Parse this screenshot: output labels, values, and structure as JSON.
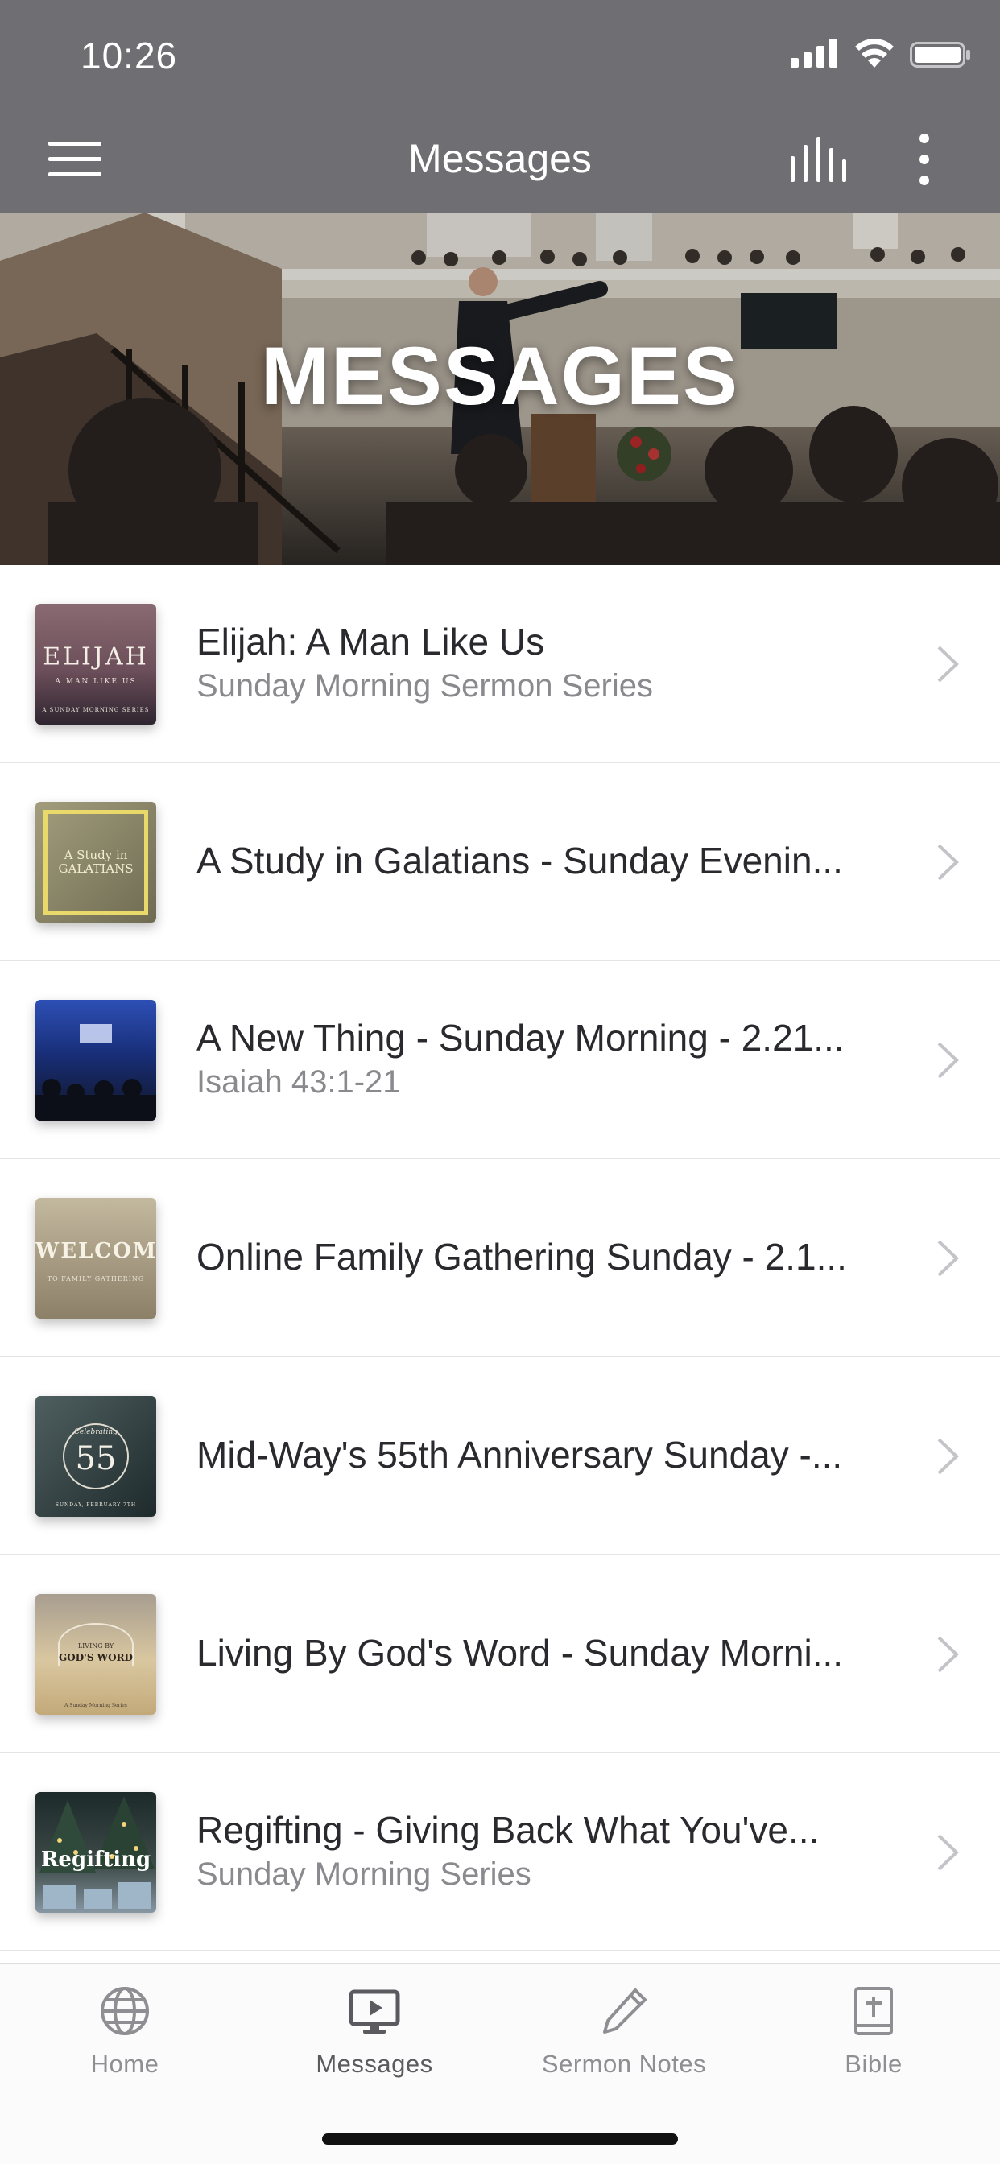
{
  "status_bar": {
    "time": "10:26"
  },
  "nav": {
    "title": "Messages"
  },
  "hero": {
    "title": "MESSAGES"
  },
  "messages": [
    {
      "title": "Elijah: A Man Like Us",
      "subtitle": "Sunday Morning Sermon Series",
      "thumb": {
        "text": "ELIJAH",
        "subtext": "A MAN LIKE US",
        "caption": "A SUNDAY MORNING SERIES",
        "colors": [
          "#3b2f3a",
          "#8a6a72"
        ]
      }
    },
    {
      "title": "A Study in Galatians - Sunday Evenin...",
      "subtitle": "",
      "thumb": {
        "text": "A Study in GALATIANS",
        "subtext": "",
        "caption": "",
        "colors": [
          "#5a5640",
          "#8b8664"
        ]
      }
    },
    {
      "title": "A New Thing - Sunday Morning - 2.21...",
      "subtitle": "Isaiah 43:1-21",
      "thumb": {
        "text": "",
        "subtext": "",
        "caption": "",
        "colors": [
          "#0f1f5a",
          "#3f5aa8"
        ]
      }
    },
    {
      "title": "Online Family Gathering Sunday - 2.1...",
      "subtitle": "",
      "thumb": {
        "text": "WELCOME",
        "subtext": "TO FAMILY GATHERING",
        "caption": "",
        "colors": [
          "#8c8068",
          "#c7bca2"
        ]
      }
    },
    {
      "title": "Mid-Way's 55th Anniversary Sunday -...",
      "subtitle": "",
      "thumb": {
        "text": "55",
        "subtext": "Celebrating",
        "caption": "SUNDAY, FEBRUARY 7TH",
        "colors": [
          "#1e2a2c",
          "#4f5f60"
        ]
      }
    },
    {
      "title": "Living By God's Word - Sunday Morni...",
      "subtitle": "",
      "thumb": {
        "text": "GOD'S WORD",
        "subtext": "LIVING BY",
        "caption": "A Sunday Morning Series",
        "colors": [
          "#9a8c78",
          "#cfb98f"
        ]
      }
    },
    {
      "title": "Regifting - Giving Back What You've...",
      "subtitle": "Sunday Morning Series",
      "thumb": {
        "text": "Regifting",
        "subtext": "",
        "caption": "",
        "colors": [
          "#1c2a2a",
          "#5b6b6a"
        ]
      }
    }
  ],
  "tabs": [
    {
      "label": "Home",
      "icon": "globe-icon",
      "active": false
    },
    {
      "label": "Messages",
      "icon": "video-play-icon",
      "active": true
    },
    {
      "label": "Sermon Notes",
      "icon": "pencil-icon",
      "active": false
    },
    {
      "label": "Bible",
      "icon": "bible-icon",
      "active": false
    }
  ]
}
